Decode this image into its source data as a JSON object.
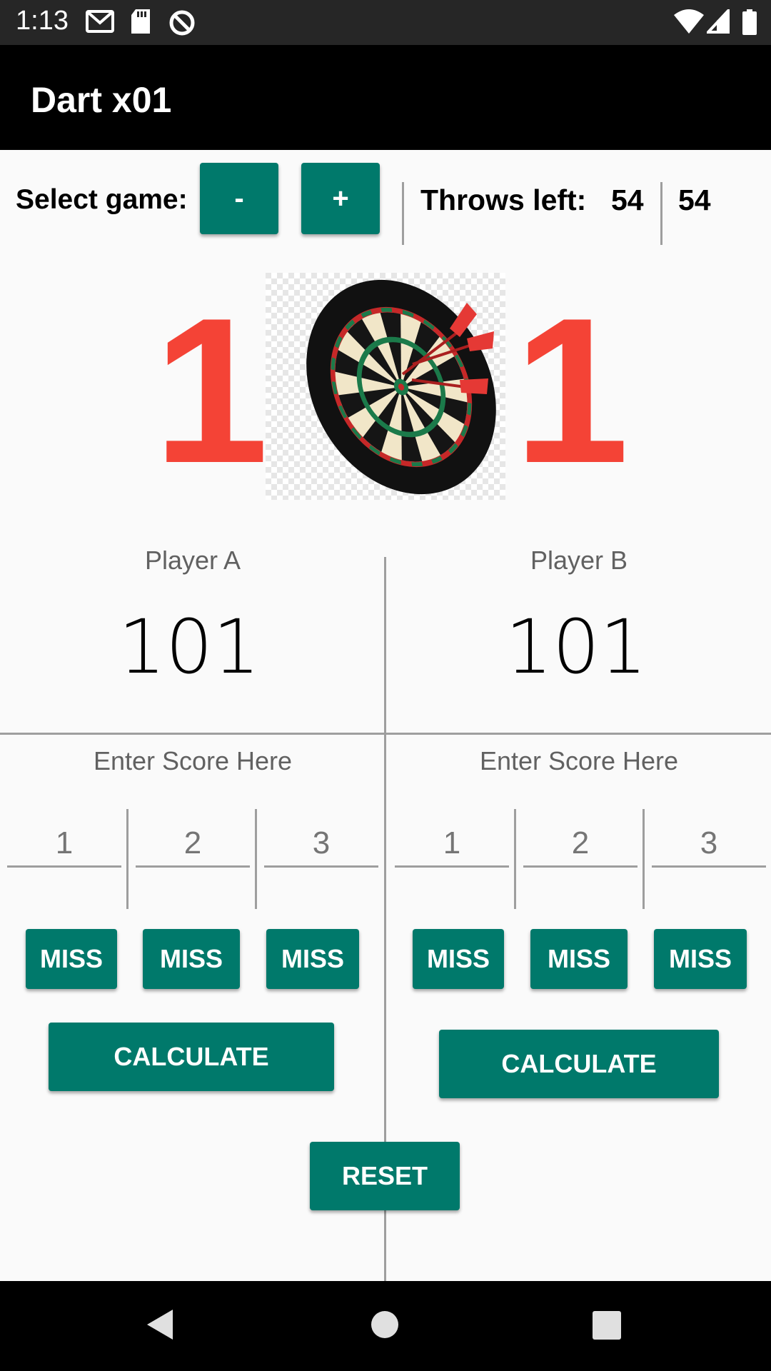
{
  "status_bar": {
    "time": "1:13",
    "icons": [
      "gmail-icon",
      "sd-card-icon",
      "data-saver-icon",
      "wifi-icon",
      "cellular-signal-icon",
      "battery-icon"
    ]
  },
  "app_bar": {
    "title": "Dart x01"
  },
  "controls": {
    "select_game_label": "Select game:",
    "minus_label": "-",
    "plus_label": "+",
    "throws_left_label": "Throws left:",
    "throws_left_a": "54",
    "throws_left_b": "54"
  },
  "legs": {
    "player_a": "1",
    "player_b": "1"
  },
  "players": [
    {
      "name": "Player A",
      "score": "101",
      "enter_label": "Enter Score Here",
      "dart_placeholders": [
        "1",
        "2",
        "3"
      ],
      "miss_label": "MISS",
      "calculate_label": "CALCULATE"
    },
    {
      "name": "Player B",
      "score": "101",
      "enter_label": "Enter Score Here",
      "dart_placeholders": [
        "1",
        "2",
        "3"
      ],
      "miss_label": "MISS",
      "calculate_label": "CALCULATE"
    }
  ],
  "reset_label": "RESET",
  "colors": {
    "accent": "#00796b",
    "leg_count": "#f44336",
    "app_bar": "#000000",
    "status_bar": "#262626"
  }
}
